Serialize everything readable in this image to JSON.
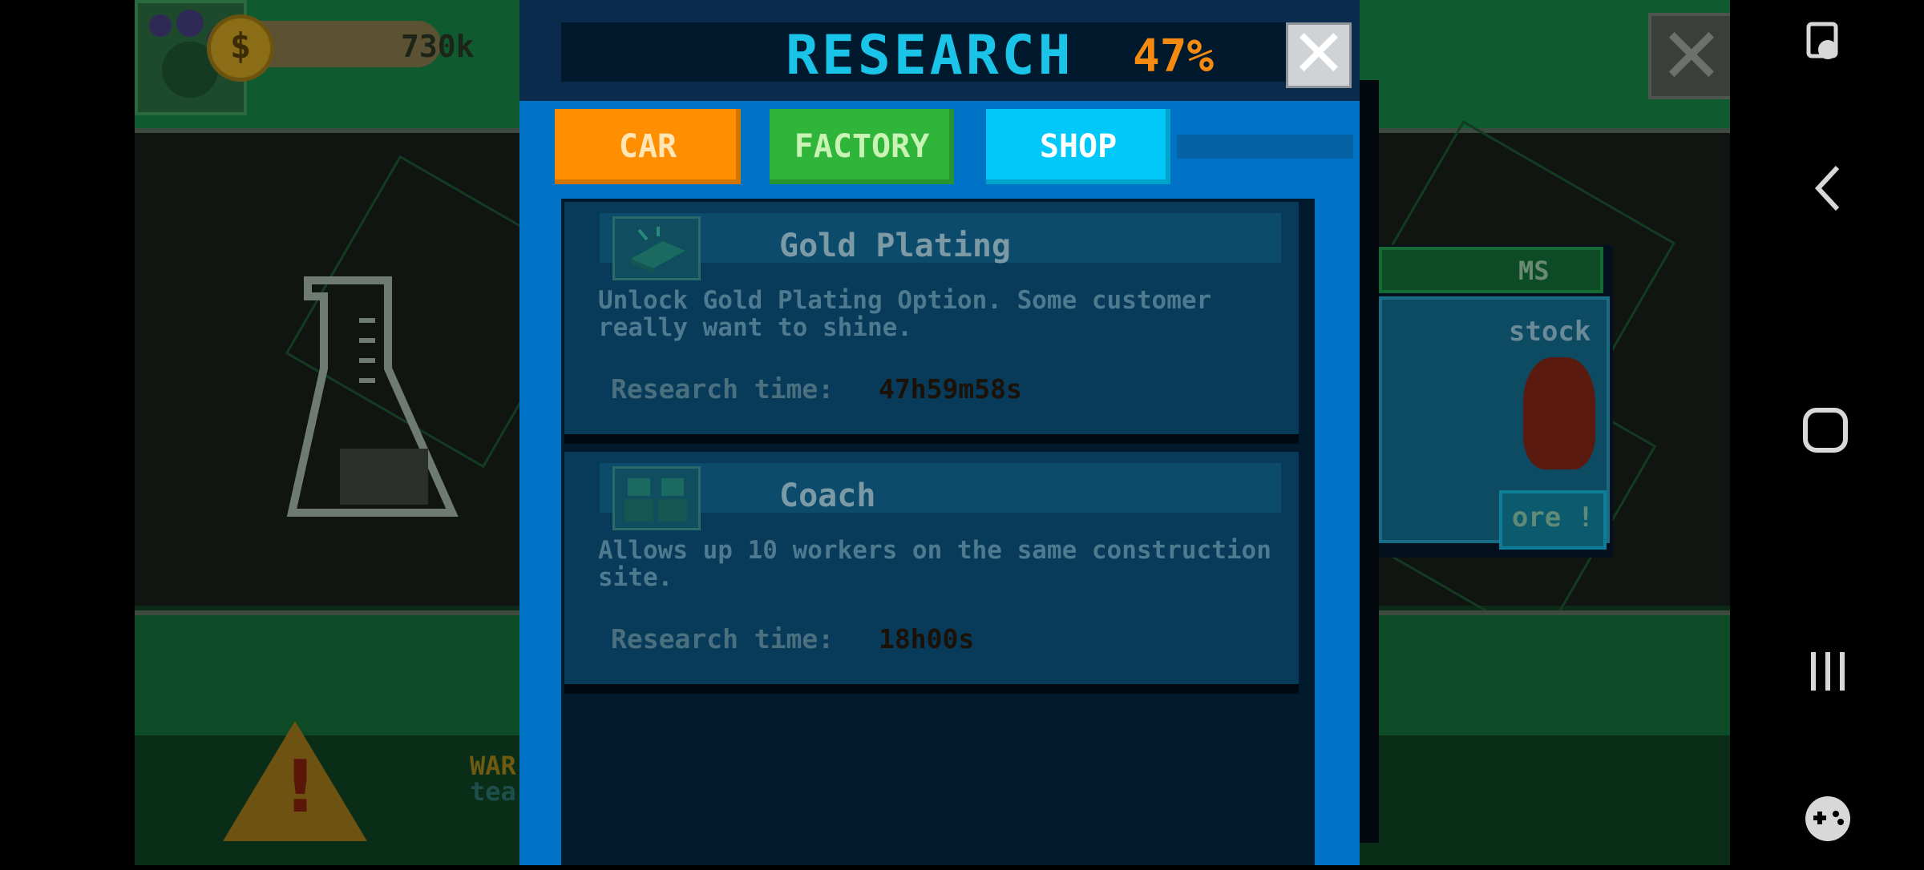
{
  "game": {
    "coins": "730k",
    "coin_symbol": "$",
    "side_card": {
      "header": "MS",
      "text": "stock",
      "button": "ore !"
    },
    "warning": {
      "line1": "WAR",
      "line2": "tea"
    }
  },
  "research": {
    "title": "RESEARCH",
    "percent": "47%",
    "close_symbol": "✕",
    "tabs": [
      {
        "label": "CAR",
        "color": "#ff8f00"
      },
      {
        "label": "FACTORY",
        "color": "#2fb53a"
      },
      {
        "label": "SHOP",
        "color": "#00c8f8"
      }
    ],
    "items": [
      {
        "title": "Gold Plating",
        "icon": "gold-bar-icon",
        "description": "Unlock Gold Plating Option. Some customer really want to shine.",
        "time_label": "Research time:",
        "time_value": "47h59m58s"
      },
      {
        "title": "Coach",
        "icon": "workers-icon",
        "description": "Allows up 10 workers on the same construction site.",
        "time_label": "Research time:",
        "time_value": "18h00s"
      }
    ]
  },
  "system_nav": {
    "items": [
      "accessibility-icon",
      "back-icon",
      "home-icon",
      "recents-icon",
      "game-launcher-icon"
    ]
  }
}
